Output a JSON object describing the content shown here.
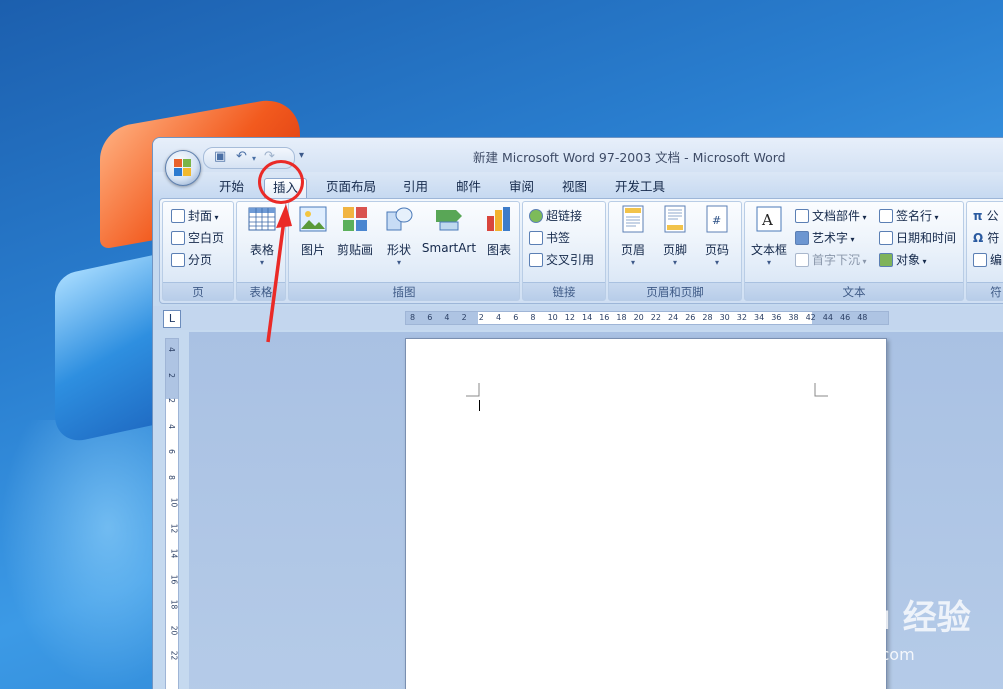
{
  "window": {
    "title": "新建 Microsoft Word 97-2003 文档 - Microsoft Word"
  },
  "qat": {
    "more": "▾"
  },
  "tabs": [
    "开始",
    "插入",
    "页面布局",
    "引用",
    "邮件",
    "审阅",
    "视图",
    "开发工具"
  ],
  "active_tab": "插入",
  "ribbon": {
    "pages": {
      "label": "页",
      "items": [
        "封面",
        "空白页",
        "分页"
      ]
    },
    "tables": {
      "label": "表格",
      "button": "表格"
    },
    "illustrations": {
      "label": "插图",
      "items": [
        "图片",
        "剪贴画",
        "形状",
        "SmartArt",
        "图表"
      ]
    },
    "links": {
      "label": "链接",
      "items": [
        "超链接",
        "书签",
        "交叉引用"
      ]
    },
    "header_footer": {
      "label": "页眉和页脚",
      "items": [
        "页眉",
        "页脚",
        "页码"
      ]
    },
    "text": {
      "label": "文本",
      "textbox": "文本框",
      "items": [
        "文档部件",
        "艺术字",
        "首字下沉",
        "签名行",
        "日期和时间",
        "对象"
      ]
    },
    "symbols": {
      "label": "符",
      "items": [
        "公",
        "符",
        "编"
      ]
    }
  },
  "ruler": {
    "corner": "L",
    "h_ticks": [
      "8",
      "6",
      "4",
      "2",
      "2",
      "4",
      "6",
      "8",
      "10",
      "12",
      "14",
      "16",
      "18",
      "20",
      "22",
      "24",
      "26",
      "28",
      "30",
      "32",
      "34",
      "36",
      "38",
      "42",
      "44",
      "46",
      "48"
    ],
    "v_ticks": [
      "4",
      "2",
      "2",
      "4",
      "6",
      "8",
      "10",
      "12",
      "14",
      "16",
      "18",
      "20",
      "22"
    ]
  },
  "watermark": {
    "brand": "Bai du 经验",
    "url": "jingyan.baidu.com"
  },
  "colors": {
    "annotation": "#ea2a27",
    "ribbon_bg": "#dde9f7"
  }
}
